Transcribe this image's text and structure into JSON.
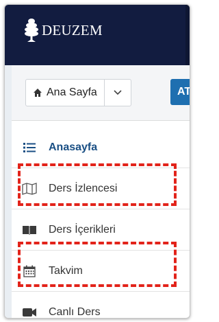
{
  "header": {
    "logo_text": "DEUZEM"
  },
  "navbar": {
    "home_label": "Ana Sayfa",
    "next_button_label": "AT"
  },
  "menu": {
    "items": [
      {
        "label": "Anasayfa",
        "icon": "list-icon",
        "active": true
      },
      {
        "label": "Ders İzlencesi",
        "icon": "map-icon",
        "active": false,
        "highlighted": true
      },
      {
        "label": "Ders İçerikleri",
        "icon": "book-open-icon",
        "active": false
      },
      {
        "label": "Takvim",
        "icon": "calendar-icon",
        "active": false,
        "highlighted": true
      },
      {
        "label": "Canlı Ders",
        "icon": "video-camera-icon",
        "active": false
      }
    ]
  },
  "colors": {
    "header_bg": "#121c40",
    "accent": "#1e6fb0",
    "active_text": "#1a4f84",
    "highlight": "#e2231a"
  }
}
